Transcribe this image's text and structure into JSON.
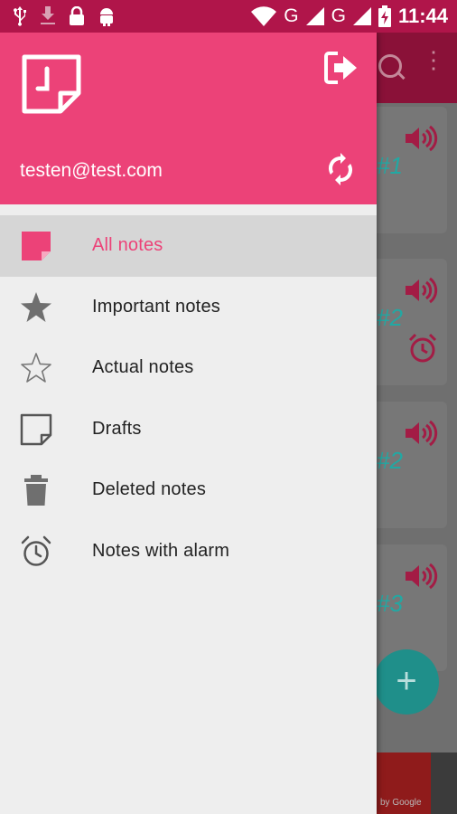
{
  "status_bar": {
    "network_1": "G",
    "network_2": "G",
    "time": "11:44"
  },
  "drawer": {
    "header": {
      "email": "testen@test.com"
    },
    "menu": [
      {
        "label": "All notes",
        "icon": "note-icon",
        "active": true
      },
      {
        "label": "Important notes",
        "icon": "star-filled-icon",
        "active": false
      },
      {
        "label": "Actual notes",
        "icon": "star-outline-icon",
        "active": false
      },
      {
        "label": "Drafts",
        "icon": "draft-note-icon",
        "active": false
      },
      {
        "label": "Deleted notes",
        "icon": "trash-icon",
        "active": false
      },
      {
        "label": "Notes with alarm",
        "icon": "alarm-clock-icon",
        "active": false
      }
    ]
  },
  "background_list": {
    "notes": [
      {
        "number_fragment": "#1"
      },
      {
        "number_fragment": "#2"
      },
      {
        "number_fragment": "#2"
      },
      {
        "number_fragment": "#3"
      }
    ],
    "fab_label": "+",
    "ad_text": "by Google"
  },
  "colors": {
    "accent": "#ec4278",
    "status_bar": "#b0154a",
    "teal": "#22a8a3"
  }
}
